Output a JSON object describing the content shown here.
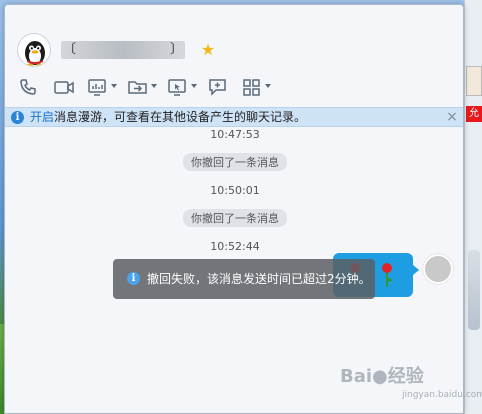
{
  "window": {
    "contact": {
      "name_left_bracket": "〔",
      "name_right_bracket": "〕",
      "star_icon": "star-icon"
    },
    "toolbar": {
      "items": [
        {
          "icon": "phone-icon"
        },
        {
          "icon": "video-icon"
        },
        {
          "icon": "screen-share-icon"
        },
        {
          "icon": "file-transfer-icon"
        },
        {
          "icon": "remote-assist-icon"
        },
        {
          "icon": "create-group-icon"
        },
        {
          "icon": "app-grid-icon"
        }
      ]
    },
    "infobar": {
      "link": "开启",
      "text": "消息漫游，可查看在其他设备产生的聊天记录。",
      "close": "×"
    },
    "messages": [
      {
        "type": "time",
        "text": "10:47:53"
      },
      {
        "type": "recall",
        "text": "你撤回了一条消息"
      },
      {
        "type": "time",
        "text": "10:50:01"
      },
      {
        "type": "recall",
        "text": "你撤回了一条消息"
      },
      {
        "type": "time",
        "text": "10:52:44"
      }
    ],
    "toast": {
      "icon": "i",
      "text": "撤回失败，该消息发送时间已超过2分钟。"
    }
  },
  "side_window": {
    "badge": "允"
  },
  "watermark": {
    "text": "Bai●经验",
    "sub": "jingyan.baidu.com"
  },
  "colors": {
    "accent": "#1e9de3",
    "infobar_bg": "#cfe3f7",
    "link": "#1a73c9",
    "star": "#f2b81a"
  }
}
